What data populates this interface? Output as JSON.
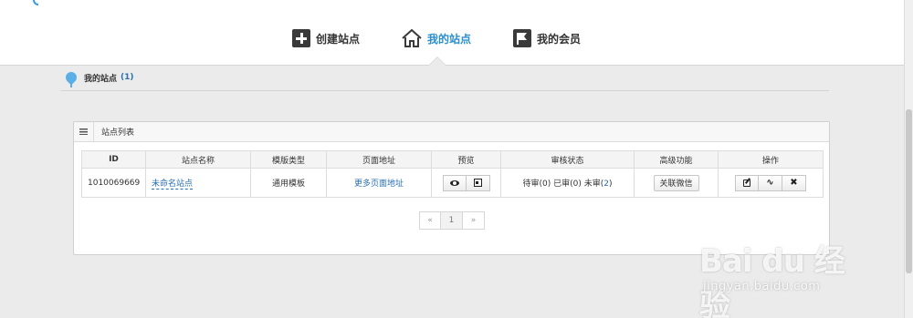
{
  "nav": {
    "items": [
      {
        "label": "创建站点",
        "icon": "plus-box-icon"
      },
      {
        "label": "我的站点",
        "icon": "home-icon",
        "active": true
      },
      {
        "label": "我的会员",
        "icon": "flag-icon"
      }
    ],
    "active_color": "#2a8fcf"
  },
  "breadcrumb": {
    "title": "我的站点",
    "count": "(1)"
  },
  "panel": {
    "title": "站点列表"
  },
  "table": {
    "headers": [
      "ID",
      "站点名称",
      "模版类型",
      "页面地址",
      "预览",
      "审核状态",
      "高级功能",
      "操作"
    ],
    "rows": [
      {
        "id": "1010069669",
        "name": "未命名站点",
        "template": "通用模板",
        "page_link": "更多页面地址",
        "audit": {
          "pending_label": "待审(0)",
          "approved_label": "已审(0)",
          "rejected_prefix": "未审(",
          "rejected_count": "2",
          "rejected_suffix": ")"
        },
        "advanced": "关联微信"
      }
    ]
  },
  "pager": {
    "prev": "«",
    "current": "1",
    "next": "»"
  },
  "watermark": {
    "main": "Bai du 经验",
    "sub": "jingyan.baidu.com"
  }
}
